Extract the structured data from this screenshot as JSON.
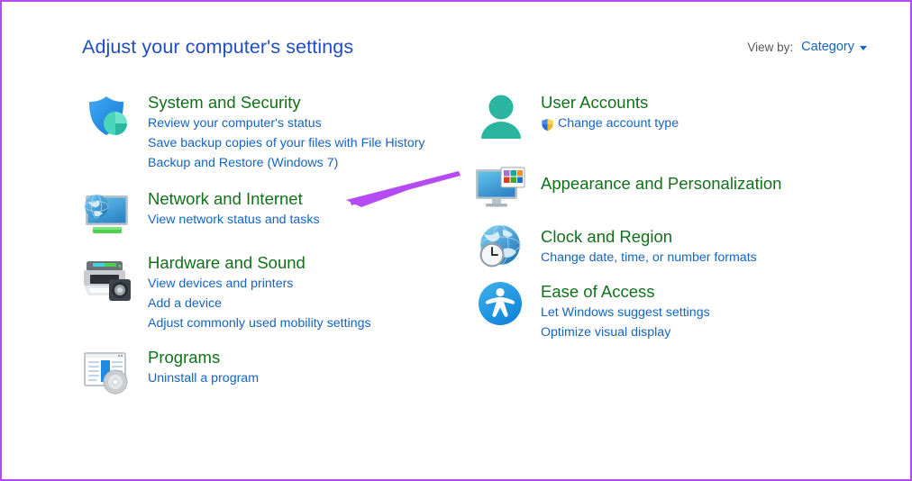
{
  "header": {
    "title": "Adjust your computer's settings",
    "view_by_label": "View by:",
    "view_by_value": "Category",
    "caret_icon": "chevron-down-icon"
  },
  "colors": {
    "title_blue": "#1f4ec4",
    "category_green": "#11711b",
    "link_blue": "#1464c0",
    "annotation_purple": "#b44bf5",
    "border_purple": "#b44bf5"
  },
  "annotation": {
    "type": "arrow",
    "color": "#b44bf5",
    "points_to": "Network and Internet"
  },
  "left_column": [
    {
      "icon": "shield-security-icon",
      "title": "System and Security",
      "links": [
        "Review your computer's status",
        "Save backup copies of your files with File History",
        "Backup and Restore (Windows 7)"
      ]
    },
    {
      "icon": "network-globe-monitor-icon",
      "title": "Network and Internet",
      "links": [
        "View network status and tasks"
      ]
    },
    {
      "icon": "printer-speaker-icon",
      "title": "Hardware and Sound",
      "links": [
        "View devices and printers",
        "Add a device",
        "Adjust commonly used mobility settings"
      ]
    },
    {
      "icon": "program-window-disc-icon",
      "title": "Programs",
      "links": [
        "Uninstall a program"
      ]
    }
  ],
  "right_column": [
    {
      "icon": "user-person-icon",
      "title": "User Accounts",
      "links": [
        {
          "text": "Change account type",
          "shield": "uac-shield-icon"
        }
      ]
    },
    {
      "icon": "monitor-tiles-icon",
      "title": "Appearance and Personalization",
      "links": []
    },
    {
      "icon": "globe-clock-icon",
      "title": "Clock and Region",
      "links": [
        {
          "text": "Change date, time, or number formats"
        }
      ]
    },
    {
      "icon": "accessibility-icon",
      "title": "Ease of Access",
      "links": [
        {
          "text": "Let Windows suggest settings"
        },
        {
          "text": "Optimize visual display"
        }
      ]
    }
  ]
}
